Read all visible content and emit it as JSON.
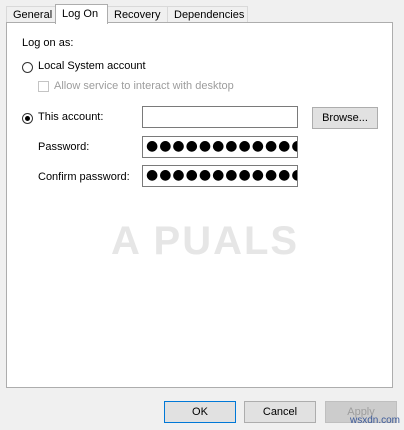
{
  "tabs": [
    {
      "label": "General",
      "active": false
    },
    {
      "label": "Log On",
      "active": true
    },
    {
      "label": "Recovery",
      "active": false
    },
    {
      "label": "Dependencies",
      "active": false
    }
  ],
  "logon": {
    "heading": "Log on as:",
    "local_system_label": "Local System account",
    "interact_desktop_label": "Allow service to interact with desktop",
    "this_account_label": "This account:",
    "account_value": "",
    "browse_label": "Browse...",
    "password_label": "Password:",
    "password_value": "●●●●●●●●●●●●●●●",
    "confirm_label": "Confirm password:",
    "confirm_value": "●●●●●●●●●●●●●●●"
  },
  "watermark": "A  PUALS",
  "footer": {
    "ok_label": "OK",
    "cancel_label": "Cancel",
    "apply_label": "Apply"
  },
  "site_label": "wsxdn.com"
}
